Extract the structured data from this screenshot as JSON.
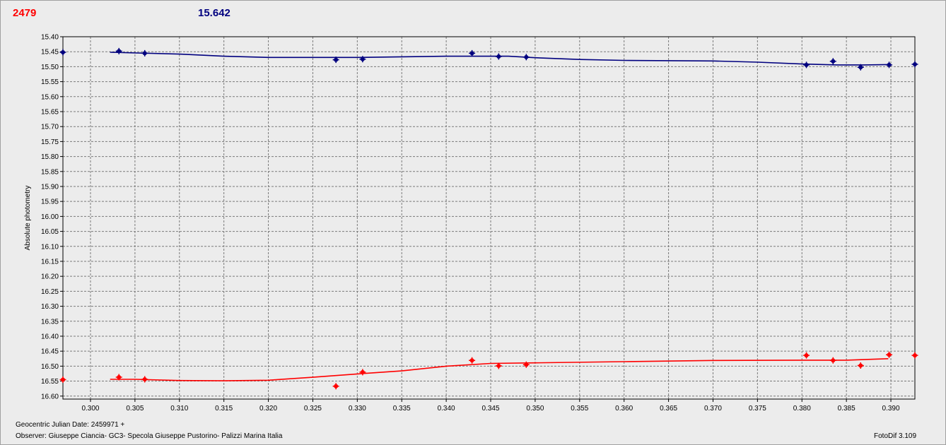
{
  "header": {
    "left_value": "2479",
    "left_color": "#ff0000",
    "right_value": "15.642",
    "right_color": "#00007f"
  },
  "footer": {
    "date_label": "Geocentric Julian Date: 2459971 +",
    "observer": "Observer: Giuseppe Ciancia- GC3- Specola Giuseppe Pustorino- Palizzi Marina Italia",
    "software": "FotoDif 3.109"
  },
  "chart_data": {
    "type": "scatter",
    "ylabel": "Absolute photometry",
    "xlabel": "",
    "xlim": [
      0.2969,
      0.3927
    ],
    "ylim": [
      15.4,
      16.61
    ],
    "y_inverted": true,
    "grid": true,
    "x_ticks": [
      0.3,
      0.305,
      0.31,
      0.315,
      0.32,
      0.325,
      0.33,
      0.335,
      0.34,
      0.345,
      0.35,
      0.355,
      0.36,
      0.365,
      0.37,
      0.375,
      0.38,
      0.385,
      0.39
    ],
    "x_tick_labels": [
      "0.300",
      "0.305",
      "0.310",
      "0.315",
      "0.320",
      "0.325",
      "0.330",
      "0.335",
      "0.340",
      "0.345",
      "0.350",
      "0.355",
      "0.360",
      "0.365",
      "0.370",
      "0.375",
      "0.380",
      "0.385",
      "0.390"
    ],
    "y_ticks": [
      15.4,
      15.45,
      15.5,
      15.55,
      15.6,
      15.65,
      15.7,
      15.75,
      15.8,
      15.85,
      15.9,
      15.95,
      16.0,
      16.05,
      16.1,
      16.15,
      16.2,
      16.25,
      16.3,
      16.35,
      16.4,
      16.45,
      16.5,
      16.55,
      16.6
    ],
    "y_tick_labels": [
      "15.40",
      "15.45",
      "15.50",
      "15.55",
      "15.60",
      "15.65",
      "15.70",
      "15.75",
      "15.80",
      "15.85",
      "15.90",
      "15.95",
      "16.00",
      "16.05",
      "16.10",
      "16.15",
      "16.20",
      "16.25",
      "16.30",
      "16.35",
      "16.40",
      "16.45",
      "16.50",
      "16.55",
      "16.60"
    ],
    "series": [
      {
        "color": "#00007f",
        "x": [
          0.2969,
          0.3032,
          0.3061,
          0.3276,
          0.3306,
          0.3429,
          0.3459,
          0.349,
          0.3805,
          0.3835,
          0.3866,
          0.3898,
          0.3927
        ],
        "y": [
          15.452,
          15.448,
          15.455,
          15.477,
          15.475,
          15.455,
          15.466,
          15.468,
          15.494,
          15.482,
          15.502,
          15.494,
          15.492
        ],
        "trend_x": [
          0.3022,
          0.31,
          0.315,
          0.32,
          0.33,
          0.34,
          0.347,
          0.35,
          0.355,
          0.36,
          0.37,
          0.375,
          0.38,
          0.384,
          0.387,
          0.3897
        ],
        "trend_y": [
          15.452,
          15.458,
          15.465,
          15.469,
          15.469,
          15.465,
          15.465,
          15.47,
          15.476,
          15.479,
          15.481,
          15.485,
          15.491,
          15.494,
          15.494,
          15.493
        ]
      },
      {
        "color": "#ff0000",
        "x": [
          0.2969,
          0.3032,
          0.3061,
          0.3276,
          0.3306,
          0.3429,
          0.3459,
          0.349,
          0.3805,
          0.3835,
          0.3866,
          0.3898,
          0.3927
        ],
        "y": [
          16.545,
          16.537,
          16.544,
          16.567,
          16.52,
          16.481,
          16.499,
          16.495,
          16.464,
          16.481,
          16.498,
          16.462,
          16.464
        ],
        "trend_x": [
          0.3022,
          0.305,
          0.31,
          0.315,
          0.32,
          0.325,
          0.33,
          0.335,
          0.34,
          0.345,
          0.35,
          0.36,
          0.37,
          0.38,
          0.385,
          0.3897
        ],
        "trend_y": [
          16.544,
          16.544,
          16.548,
          16.549,
          16.547,
          16.537,
          16.526,
          16.516,
          16.5,
          16.491,
          16.489,
          16.485,
          16.481,
          16.48,
          16.48,
          16.475
        ]
      }
    ]
  }
}
